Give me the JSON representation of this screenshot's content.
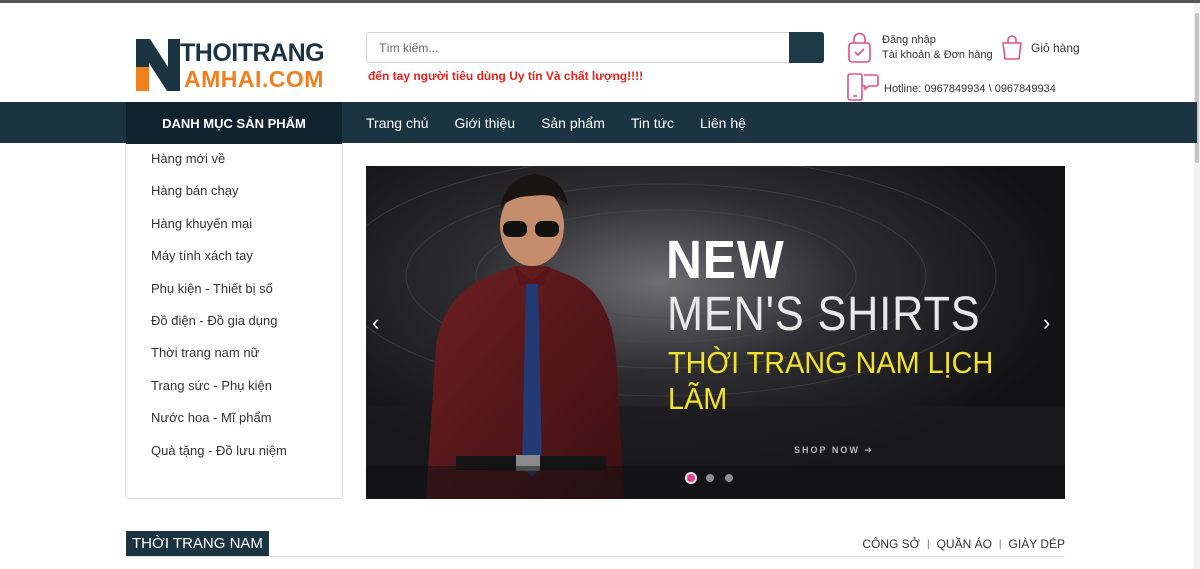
{
  "header": {
    "logo": {
      "line1": "THOITRANG",
      "line2": "AMHAI.COM"
    },
    "search": {
      "placeholder": "Tìm kiếm..."
    },
    "slogan": "đến tay người tiêu dùng Uy tín Và chất lượng!!!!",
    "account": {
      "login": "Đăng nhập",
      "sub": "Tài khoản & Đơn hàng"
    },
    "cart": {
      "label": "Giỏ hàng"
    },
    "hotline": "Hotline: 0967849934 \\ 0967849934"
  },
  "nav": {
    "category_title": "DANH MỤC SẢN PHẨM",
    "items": [
      "Trang chủ",
      "Giới thiệu",
      "Sản phẩm",
      "Tin tức",
      "Liên hệ"
    ]
  },
  "sidebar": {
    "items": [
      "Hàng mới về",
      "Hàng bán chạy",
      "Hàng khuyến mại",
      "Máy tính xách tay",
      "Phụ kiện - Thiết bị số",
      "Đồ điện - Đồ gia dụng",
      "Thời trang nam nữ",
      "Trang sức - Phụ kiện",
      "Nước hoa - Mĩ phẩm",
      "Quà tặng - Đồ lưu niệm"
    ]
  },
  "banner": {
    "new": "NEW",
    "title": "MEN'S SHIRTS",
    "tagline": "THỜI TRANG NAM LỊCH LÃM",
    "shop_now": "SHOP NOW",
    "slides": 3,
    "active_slide": 1
  },
  "section": {
    "title": "THỜI TRANG NAM",
    "links": [
      "CÔNG SỞ",
      "QUẦN ÁO",
      "GIÀY DÉP"
    ],
    "separator": "|"
  },
  "colors": {
    "navy": "#1b3442",
    "orange": "#f07f1f",
    "slogan_red": "#e8231b",
    "banner_yellow": "#f2e22a",
    "icon_pink": "#e0527f"
  }
}
